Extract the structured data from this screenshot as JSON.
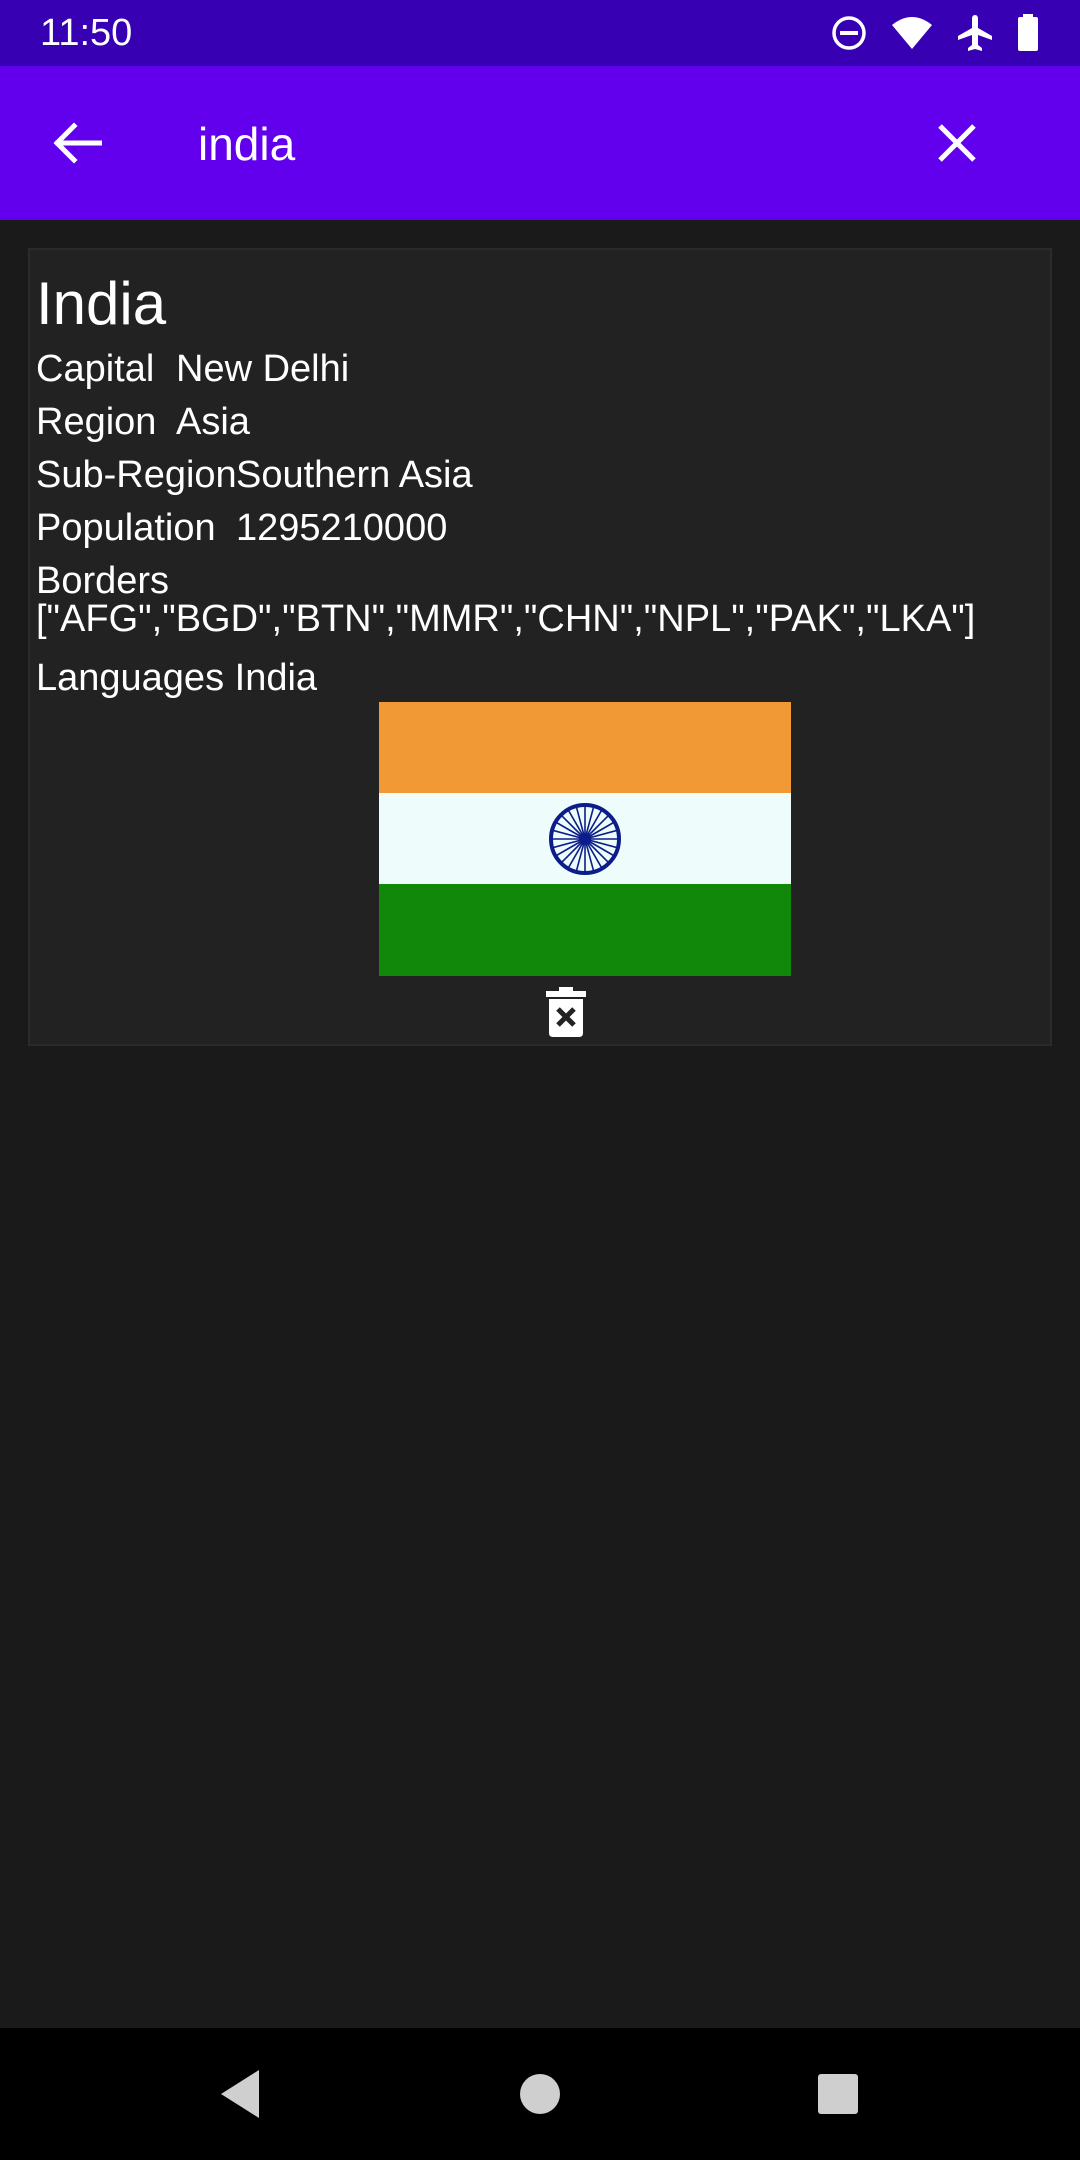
{
  "status_bar": {
    "time": "11:50",
    "icons": [
      "do-not-disturb-icon",
      "wifi-icon",
      "airplane-mode-icon",
      "battery-icon"
    ]
  },
  "app_bar": {
    "search_value": "india",
    "back_icon": "arrow-back-icon",
    "clear_icon": "close-icon",
    "color": "#6200ee",
    "status_color": "#3700b3"
  },
  "country": {
    "name": "India",
    "capital_label": "Capital",
    "capital_value": "New Delhi",
    "region_label": "Region",
    "region_value": "Asia",
    "subregion_label": "Sub-Region",
    "subregion_value": "Southern Asia",
    "population_label": "Population",
    "population_value": "1295210000",
    "borders_label": "Borders",
    "borders_value": "[\"AFG\",\"BGD\",\"BTN\",\"MMR\",\"CHN\",\"NPL\",\"PAK\",\"LKA\"]",
    "languages_label": "Languages",
    "languages_value": "India",
    "flag": {
      "top_color": "#f19935",
      "middle_color": "#eefdfc",
      "bottom_color": "#12880a",
      "chakra_color": "#0c1d8a"
    },
    "delete_icon": "delete-forever-icon"
  },
  "nav_bar": {
    "back": "nav-back-icon",
    "home": "nav-home-icon",
    "recents": "nav-recents-icon"
  }
}
